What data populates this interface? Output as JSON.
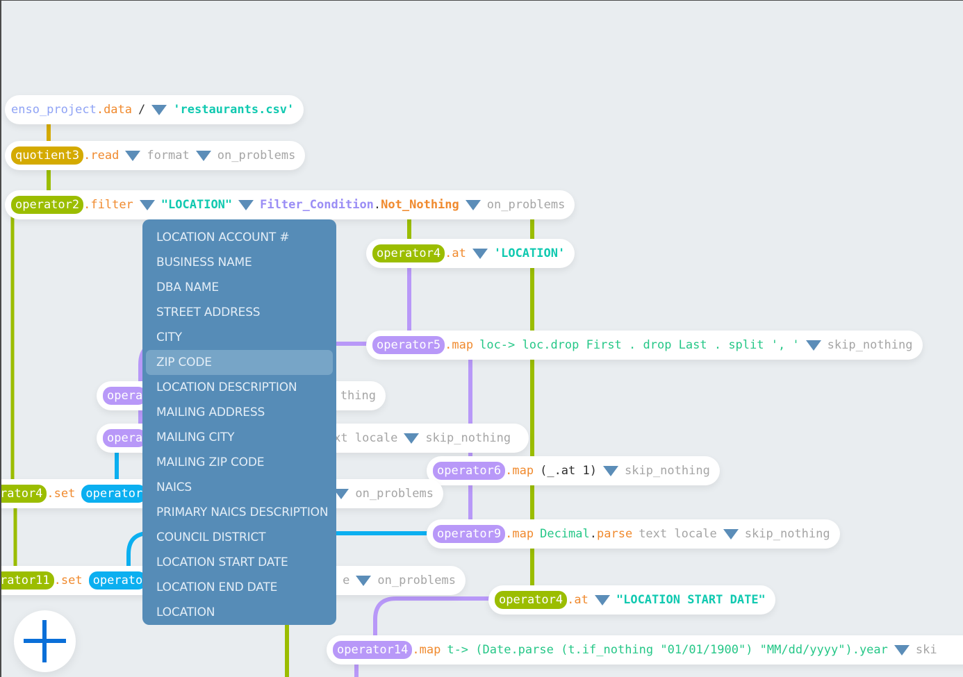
{
  "colors": {
    "canvas": "#e9edf0",
    "yellow": "#d4aa00",
    "green": "#9bbd00",
    "purple": "#b898f8",
    "blue": "#0baff0",
    "dropdown_bg": "#568cb7",
    "dropdown_selected": "#77a5c7",
    "add_button": "#0a6fd8"
  },
  "nodes": {
    "n1": {
      "a": "enso_project",
      "b": ".data",
      "c": "/",
      "d": "'restaurants.csv'"
    },
    "n2": {
      "pill": "quotient3",
      "method": "read",
      "arg1": "format",
      "arg2": "on_problems"
    },
    "n3": {
      "pill": "operator2",
      "method": "filter",
      "arg1": "\"LOCATION\"",
      "arg2a": "Filter_Condition",
      "arg2b": "Not_Nothing",
      "arg3": "on_problems"
    },
    "n4": {
      "pill": "operator4",
      "method": "at",
      "arg1": "'LOCATION'"
    },
    "n5": {
      "pill": "operator5",
      "method": "map",
      "expr": "loc-> loc.drop First . drop Last . split ', '",
      "arg": "skip_nothing"
    },
    "n6": {
      "pill": "opera",
      "tail": "thing"
    },
    "n7": {
      "pill": "opera",
      "tail1": "xt locale",
      "arg": "skip_nothing"
    },
    "n8": {
      "pill": "operator6",
      "method": "map",
      "expr": "(_.at 1)",
      "arg": "skip_nothing"
    },
    "n9": {
      "pill": "rator4",
      "method": "set",
      "pill2": "operator",
      "arg": "on_problems"
    },
    "n10": {
      "pill": "operator9",
      "method": "map",
      "expr1": "Decimal",
      "expr2": "parse",
      "expr3": "text locale",
      "arg": "skip_nothing"
    },
    "n11": {
      "pill": "rator11",
      "method": "set",
      "pill2": "operato",
      "tail": "e",
      "arg": "on_problems"
    },
    "n12": {
      "pill": "operator4",
      "method": "at",
      "arg1": "\"LOCATION START DATE\""
    },
    "n13": {
      "pill": "operator14",
      "method": "map",
      "expr": "t-> (Date.parse (t.if_nothing \"01/01/1900\") \"MM/dd/yyyy\").year",
      "arg": "ski"
    }
  },
  "dropdown": {
    "items": [
      "LOCATION ACCOUNT #",
      "BUSINESS NAME",
      "DBA NAME",
      "STREET ADDRESS",
      "CITY",
      "ZIP CODE",
      "LOCATION DESCRIPTION",
      "MAILING ADDRESS",
      "MAILING CITY",
      "MAILING ZIP CODE",
      "NAICS",
      "PRIMARY NAICS DESCRIPTION",
      "COUNCIL DISTRICT",
      "LOCATION START DATE",
      "LOCATION END DATE",
      "LOCATION"
    ],
    "selected": "ZIP CODE"
  },
  "add_button": {
    "icon": "plus-icon"
  }
}
